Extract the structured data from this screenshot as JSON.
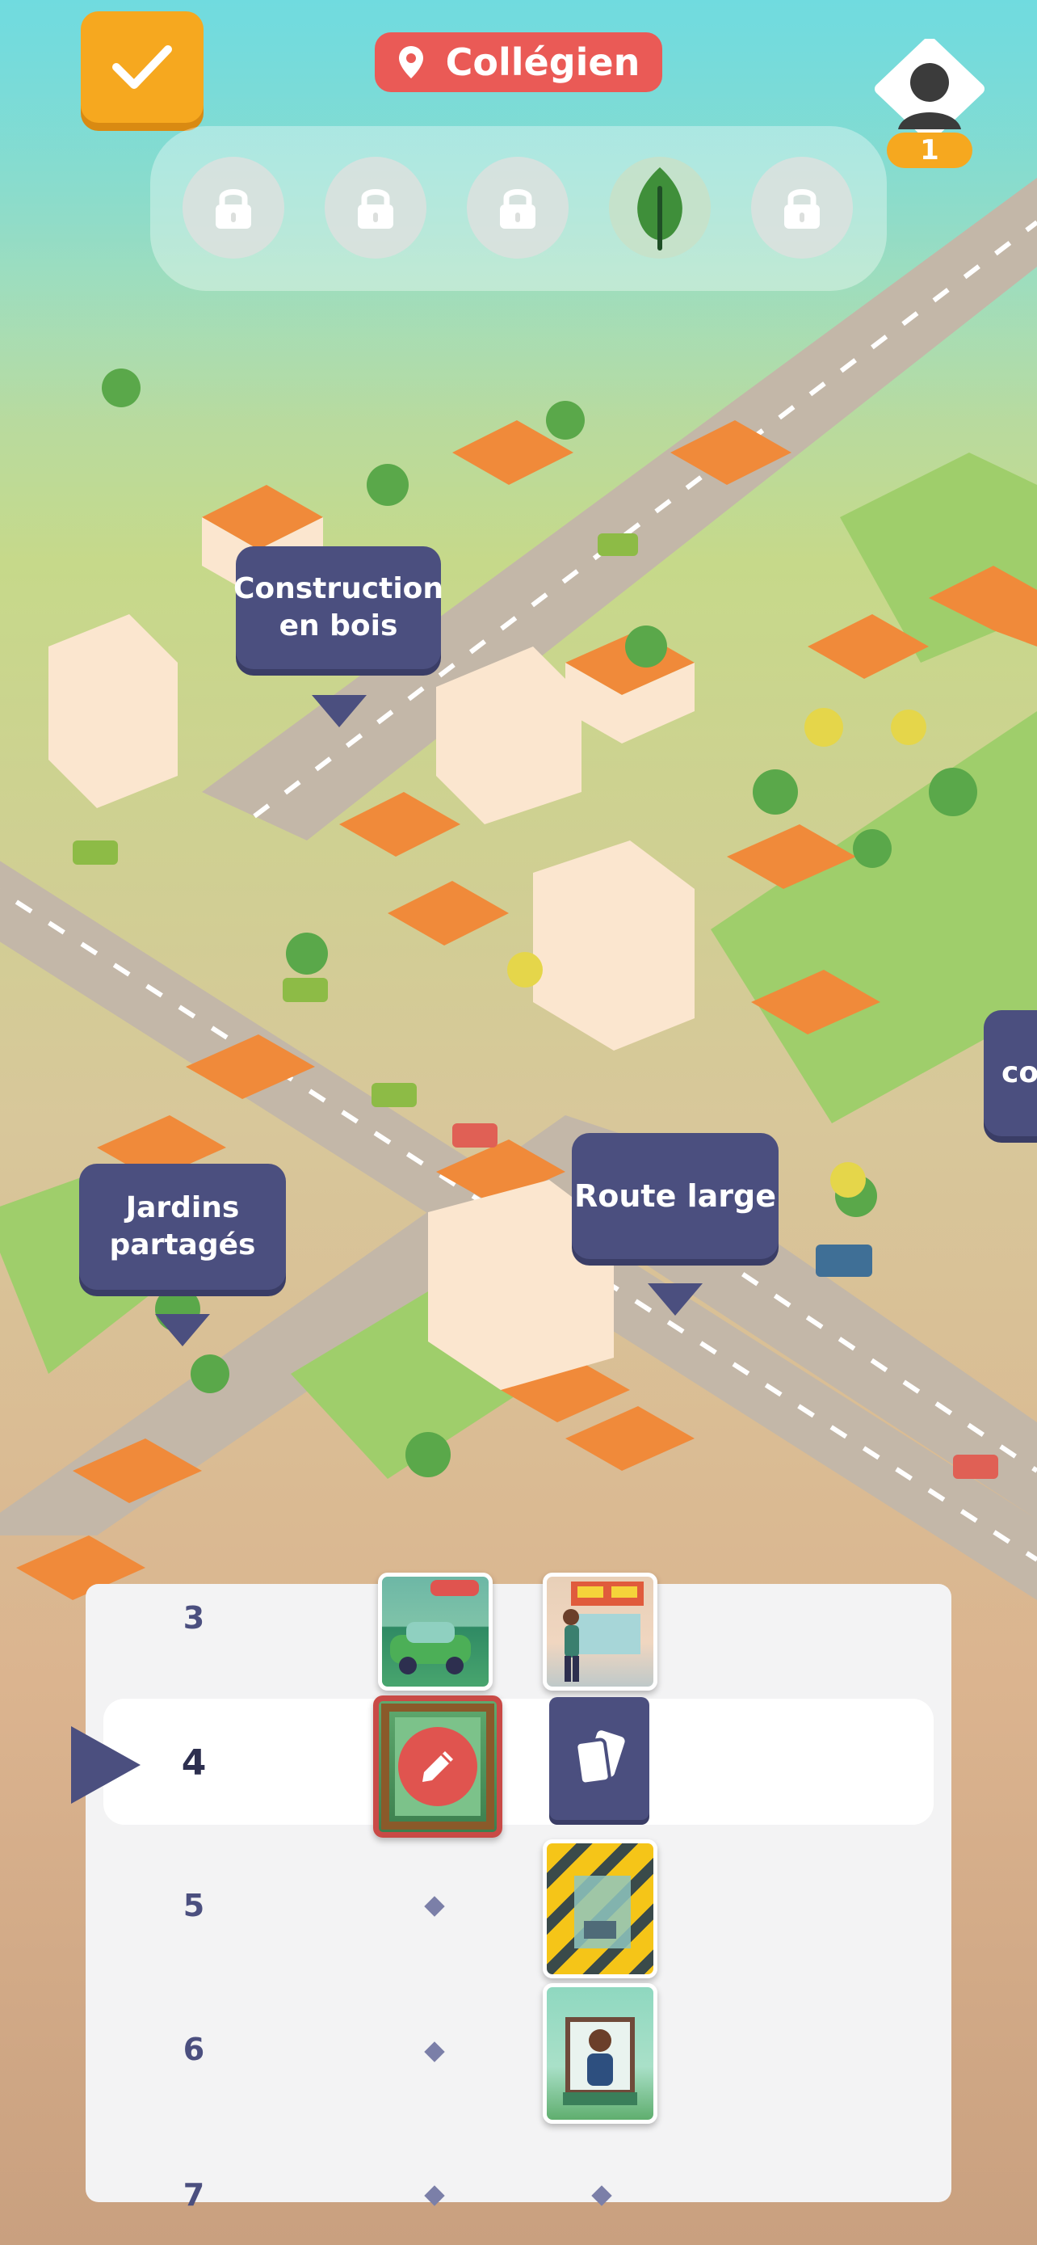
{
  "header": {
    "confirm_icon": "checkmark-icon",
    "location_icon": "map-pin-icon",
    "location_label": "Collégien",
    "player_count": "1"
  },
  "lock_slots": [
    {
      "state": "locked",
      "icon": "lock-icon"
    },
    {
      "state": "locked",
      "icon": "lock-icon"
    },
    {
      "state": "locked",
      "icon": "lock-icon"
    },
    {
      "state": "unlocked",
      "icon": "leaf-icon"
    },
    {
      "state": "locked",
      "icon": "lock-icon"
    }
  ],
  "map_labels": {
    "construction": "Construction\nen bois",
    "jardins": "Jardins\npartagés",
    "route": "Route large",
    "partial": "co"
  },
  "timeline": {
    "rows": [
      "3",
      "4",
      "5",
      "6",
      "7"
    ],
    "current_row": "4"
  },
  "colors": {
    "accent": "#f6a81f",
    "location": "#ea5a56",
    "label_bg": "#4b4f7f",
    "panel_bg": "#f3f3f4"
  }
}
